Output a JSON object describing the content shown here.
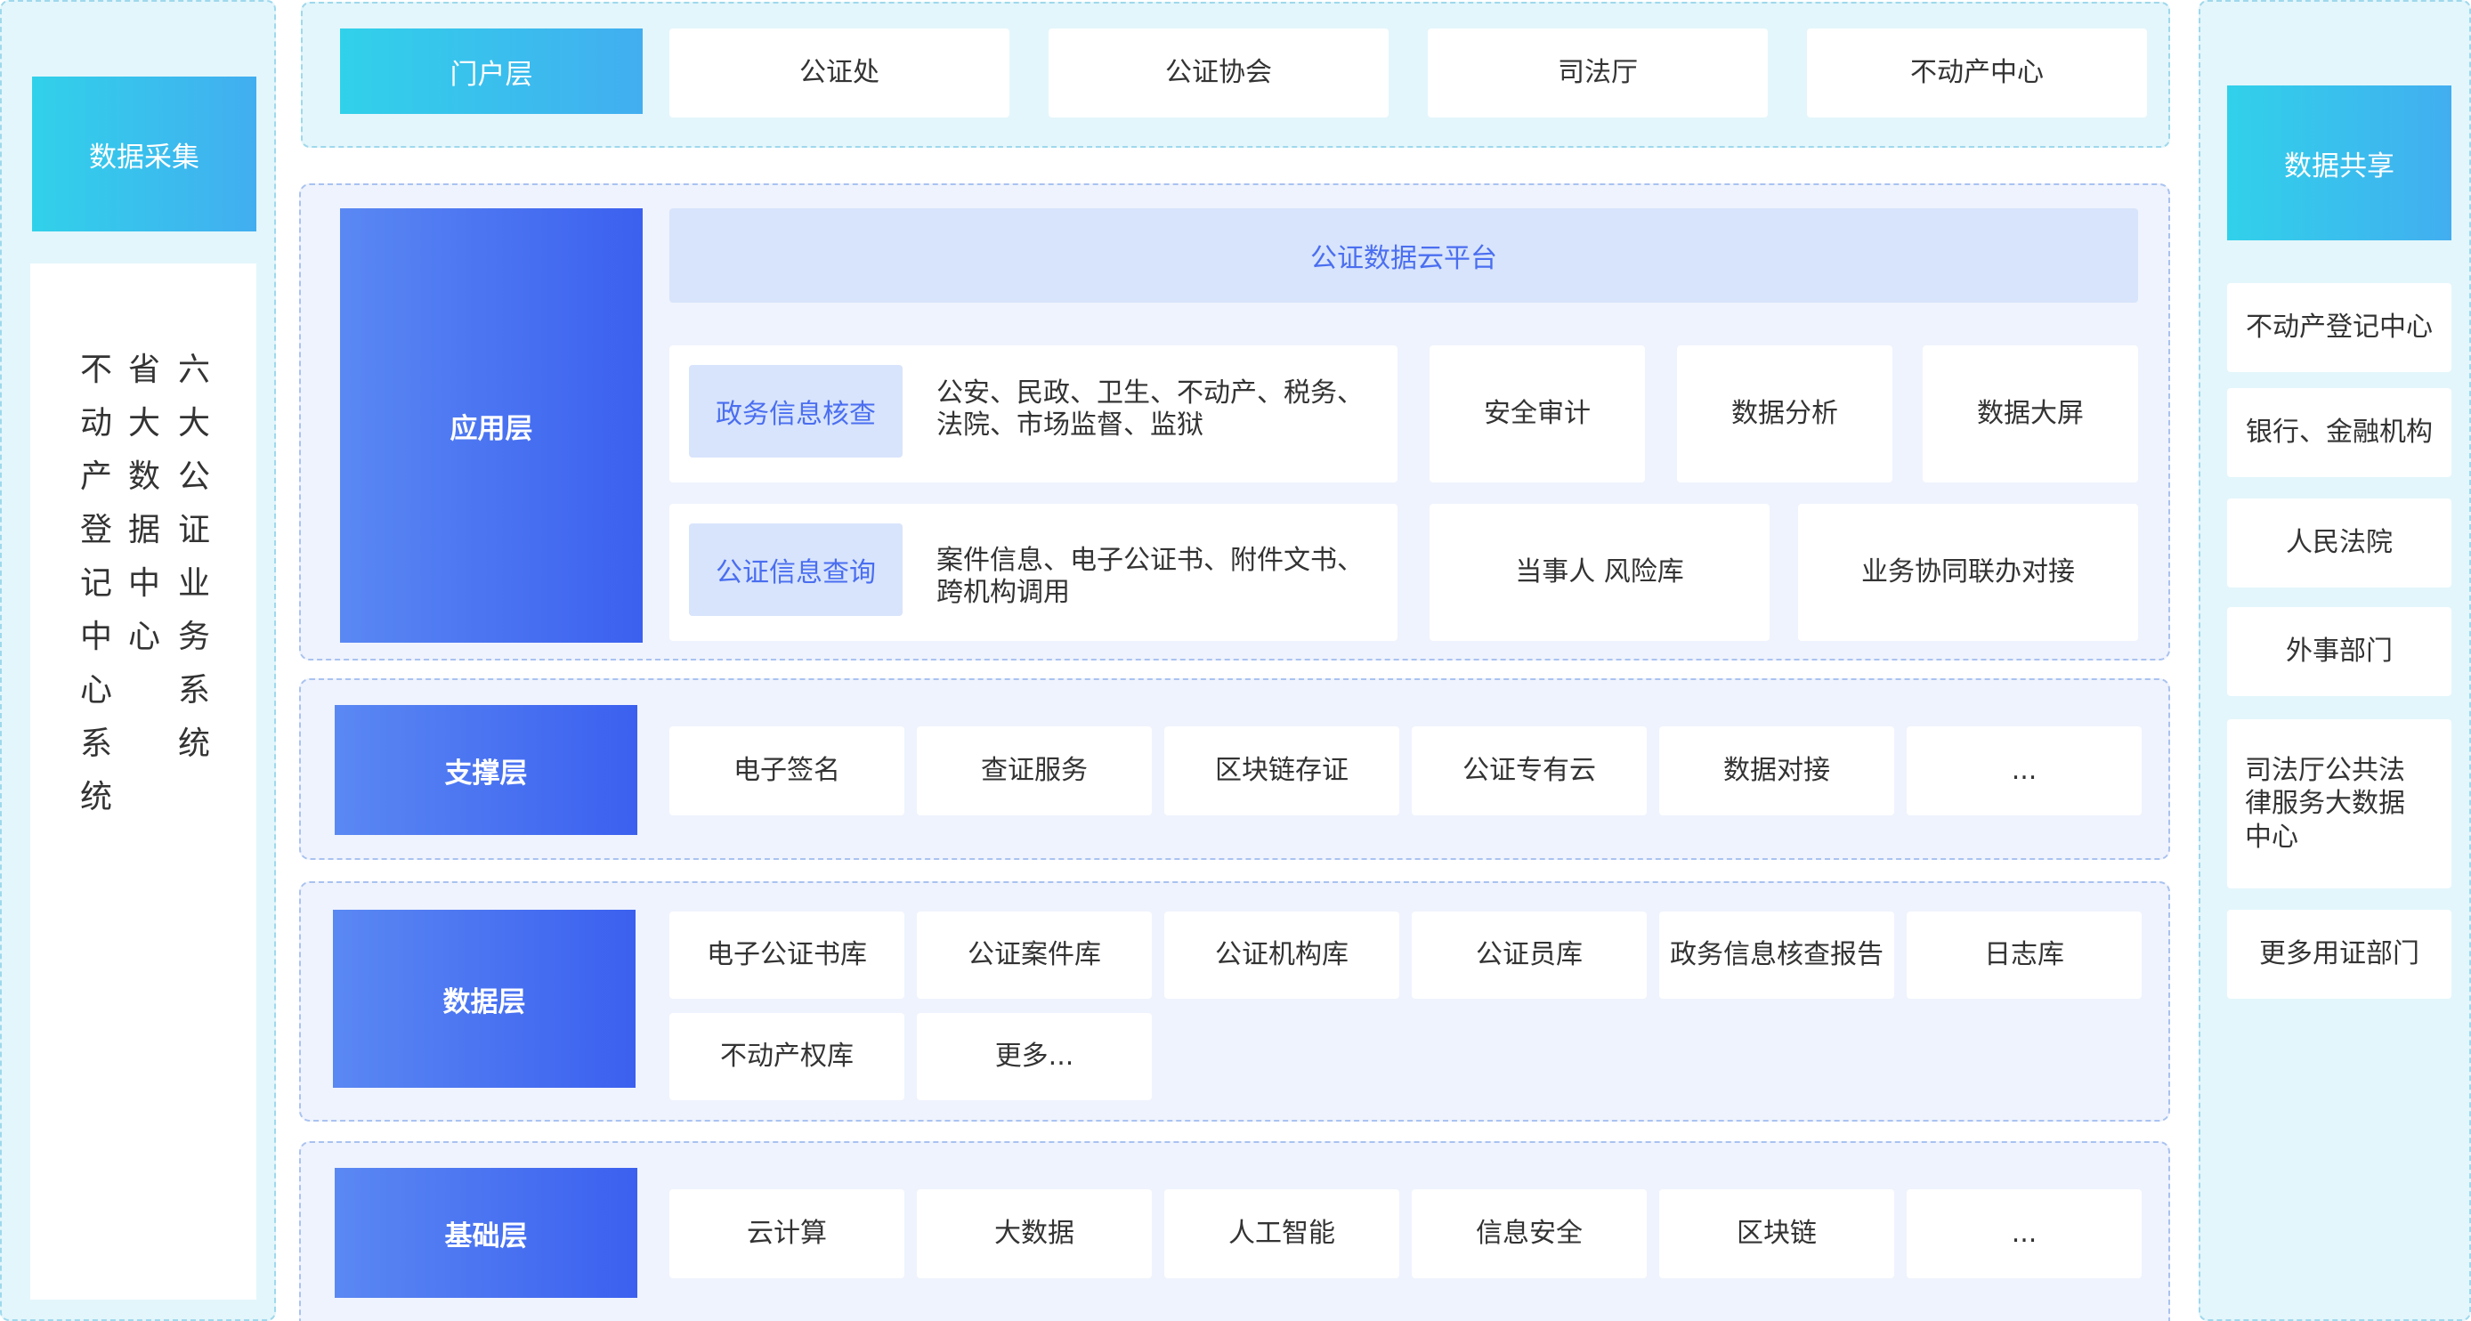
{
  "left": {
    "header": "数据采集",
    "columns": [
      [
        "不",
        "动",
        "产",
        "登",
        "记",
        "中",
        "心",
        "系",
        "统"
      ],
      [
        "省",
        "大",
        "数",
        "据",
        "中",
        "心"
      ],
      [
        "六",
        "大",
        "公",
        "证",
        "业",
        "务",
        "系",
        "统"
      ]
    ]
  },
  "right": {
    "header": "数据共享",
    "items": [
      "不动产登记中心",
      "银行、金融机构",
      "人民法院",
      "外事部门",
      "司法厅公共法律服务大数据中心",
      "更多用证部门"
    ]
  },
  "portal": {
    "label": "门户层",
    "items": [
      "公证处",
      "公证协会",
      "司法厅",
      "不动产中心"
    ]
  },
  "app": {
    "label": "应用层",
    "platform": "公证数据云平台",
    "row1": {
      "tag": "政务信息核查",
      "desc_line1": "公安、民政、卫生、不动产、税务、",
      "desc_line2": "法院、市场监督、监狱",
      "items": [
        "安全审计",
        "数据分析",
        "数据大屏"
      ]
    },
    "row2": {
      "tag": "公证信息查询",
      "desc_line1": "案件信息、电子公证书、附件文书、",
      "desc_line2": "跨机构调用",
      "items": [
        "当事人 风险库",
        "业务协同联办对接"
      ]
    }
  },
  "support": {
    "label": "支撑层",
    "items": [
      "电子签名",
      "查证服务",
      "区块链存证",
      "公证专有云",
      "数据对接",
      "..."
    ]
  },
  "data": {
    "label": "数据层",
    "row1": [
      "电子公证书库",
      "公证案件库",
      "公证机构库",
      "公证员库",
      "政务信息核查报告",
      "日志库"
    ],
    "row2": [
      "不动产权库",
      "更多..."
    ]
  },
  "base": {
    "label": "基础层",
    "items": [
      "云计算",
      "大数据",
      "人工智能",
      "信息安全",
      "区块链",
      "..."
    ]
  }
}
